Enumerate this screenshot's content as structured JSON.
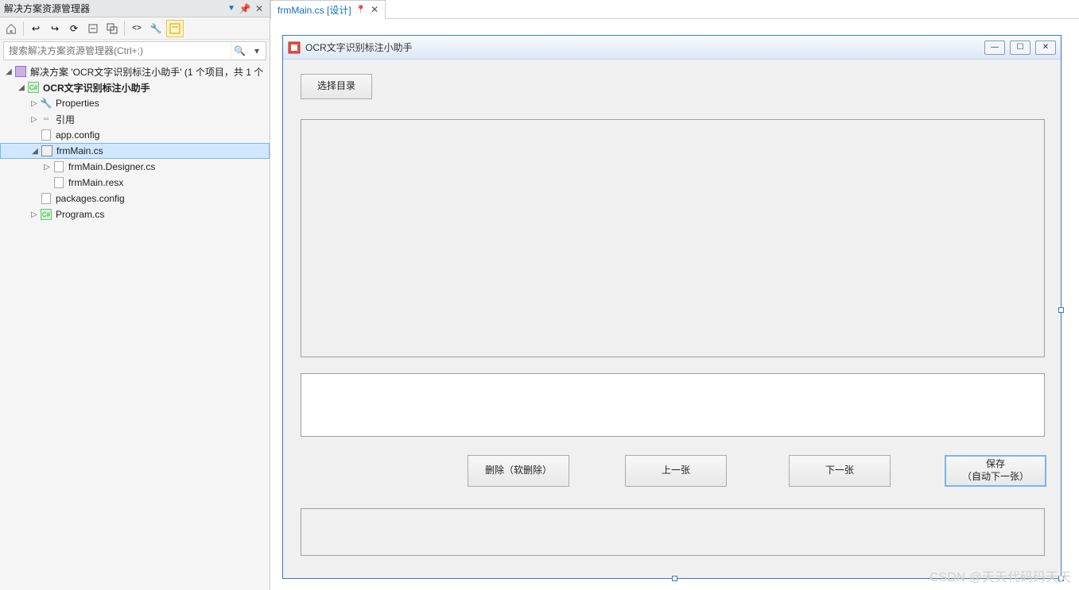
{
  "panel": {
    "title": "解决方案资源管理器",
    "searchPlaceholder": "搜索解决方案资源管理器(Ctrl+;)"
  },
  "tree": {
    "solution": "解决方案 'OCR文字识别标注小助手' (1 个项目，共 1 个",
    "project": "OCR文字识别标注小助手",
    "properties": "Properties",
    "references": "引用",
    "appconfig": "app.config",
    "frmMain": "frmMain.cs",
    "frmDesigner": "frmMain.Designer.cs",
    "frmResx": "frmMain.resx",
    "packages": "packages.config",
    "program": "Program.cs"
  },
  "tab": {
    "name": "frmMain.cs [设计]"
  },
  "form": {
    "title": "OCR文字识别标注小助手",
    "btnSelectDir": "选择目录",
    "btnDelete": "删除（软删除）",
    "btnPrev": "上一张",
    "btnNext": "下一张",
    "btnSaveLine1": "保存",
    "btnSaveLine2": "（自动下一张）"
  },
  "watermark": "CSDN @天天代码码天天"
}
